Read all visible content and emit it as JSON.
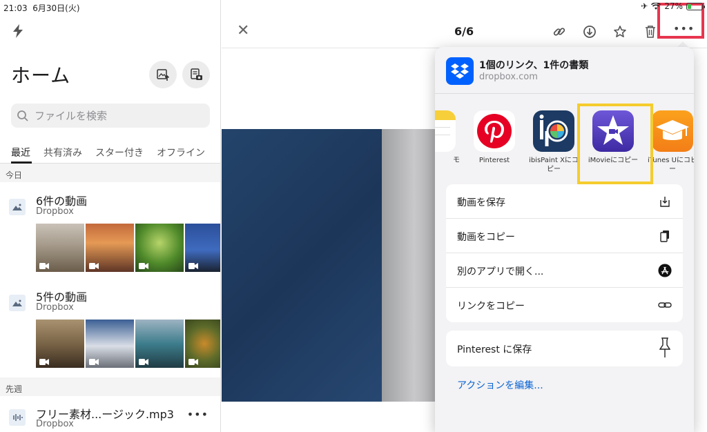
{
  "status": {
    "time": "21:03",
    "date": "6月30日(火)",
    "battery": "27%",
    "battery_level": 0.27
  },
  "sidebar": {
    "title": "ホーム",
    "search_placeholder": "ファイルを検索",
    "tabs": [
      "最近",
      "共有済み",
      "スター付き",
      "オフライン"
    ],
    "sections": [
      {
        "header": "今日",
        "groups": [
          {
            "title": "6件の動画",
            "subtitle": "Dropbox"
          },
          {
            "title": "5件の動画",
            "subtitle": "Dropbox"
          }
        ]
      },
      {
        "header": "先週",
        "file": {
          "title": "フリー素材...ージック.mp3",
          "subtitle": "Dropbox"
        }
      }
    ]
  },
  "viewer": {
    "counter": "6/6"
  },
  "share": {
    "title": "1個のリンク、1件の書類",
    "domain": "dropbox.com",
    "apps": [
      {
        "label": "モ",
        "icon": "notes-icon"
      },
      {
        "label": "Pinterest",
        "icon": "pinterest-icon"
      },
      {
        "label": "ibisPaint Xにコピー",
        "icon": "ibispaint-icon"
      },
      {
        "label": "iMovieにコピー",
        "icon": "imovie-icon"
      },
      {
        "label": "iTunes Uにコピー",
        "icon": "itunes-u-icon"
      }
    ],
    "actions": [
      {
        "label": "動画を保存",
        "icon": "save-download-icon"
      },
      {
        "label": "動画をコピー",
        "icon": "copy-document-icon"
      },
      {
        "label": "別のアプリで開く...",
        "icon": "app-store-icon"
      },
      {
        "label": "リンクをコピー",
        "icon": "link-icon"
      }
    ],
    "pinterest_action": {
      "label": "Pinterest に保存",
      "icon": "pushpin-icon"
    },
    "edit_actions": "アクションを編集..."
  },
  "colors": {
    "accent": "#0a64d3",
    "dropbox": "#0061fe",
    "highlight_red": "#e8364f",
    "highlight_yellow": "#f5cc2d"
  }
}
